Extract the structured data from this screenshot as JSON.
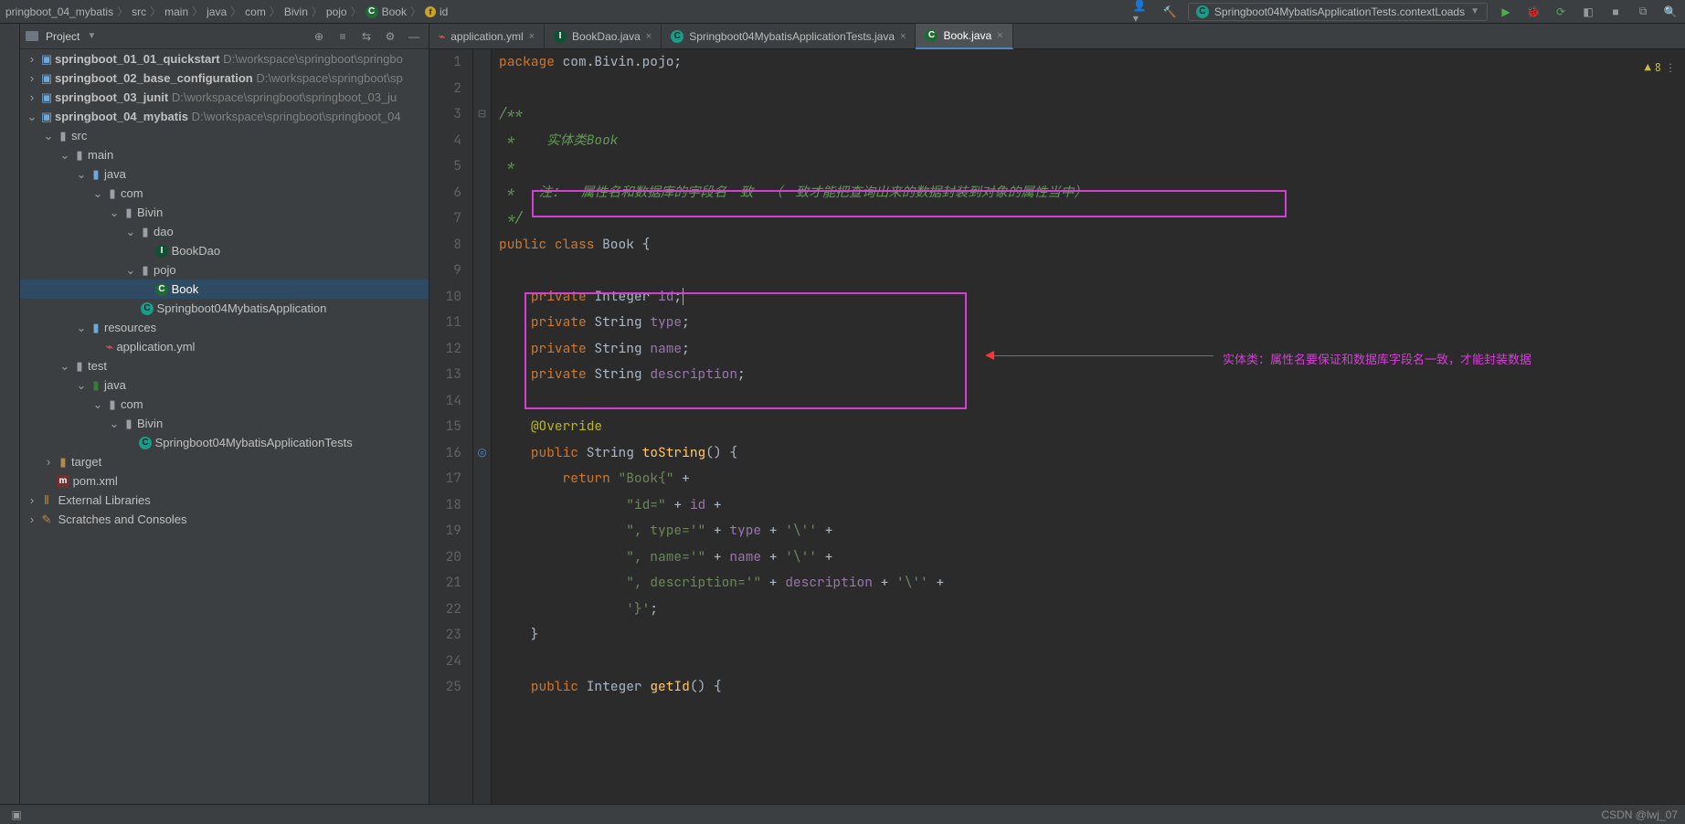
{
  "breadcrumbs": [
    "pringboot_04_mybatis",
    "src",
    "main",
    "java",
    "com",
    "Bivin",
    "pojo",
    "Book",
    "id"
  ],
  "run_config": "Springboot04MybatisApplicationTests.contextLoads",
  "project_panel_title": "Project",
  "tree": {
    "mods": [
      {
        "name": "springboot_01_01_quickstart",
        "path": "D:\\workspace\\springboot\\springbo"
      },
      {
        "name": "springboot_02_base_configuration",
        "path": "D:\\workspace\\springboot\\sp"
      },
      {
        "name": "springboot_03_junit",
        "path": "D:\\workspace\\springboot\\springboot_03_ju"
      },
      {
        "name": "springboot_04_mybatis",
        "path": "D:\\workspace\\springboot\\springboot_04"
      }
    ],
    "src": "src",
    "main": "main",
    "java": "java",
    "com": "com",
    "Bivin": "Bivin",
    "dao": "dao",
    "BookDao": "BookDao",
    "pojo": "pojo",
    "Book": "Book",
    "AppMain": "Springboot04MybatisApplication",
    "resources": "resources",
    "appyml": "application.yml",
    "test": "test",
    "java2": "java",
    "com2": "com",
    "Bivin2": "Bivin",
    "AppTests": "Springboot04MybatisApplicationTests",
    "target": "target",
    "pom": "pom.xml",
    "extlibs": "External Libraries",
    "scratches": "Scratches and Consoles"
  },
  "tabs": [
    {
      "label": "application.yml",
      "kind": "yml"
    },
    {
      "label": "BookDao.java",
      "kind": "iface"
    },
    {
      "label": "Springboot04MybatisApplicationTests.java",
      "kind": "class"
    },
    {
      "label": "Book.java",
      "kind": "class",
      "active": true
    }
  ],
  "code": {
    "l1": "package com.Bivin.pojo;",
    "l2": "",
    "l3": "/**",
    "l4": " *    实体类Book",
    "l5": " *",
    "l6": " *   注：  属性名和数据库的字段名一致  （一致才能把查询出来的数据封装到对象的属性当中）",
    "l7": " */",
    "l8": "public class Book {",
    "l9": "",
    "l10": "    private Integer id;",
    "l11": "    private String type;",
    "l12": "    private String name;",
    "l13": "    private String description;",
    "l14": "",
    "l15": "    @Override",
    "l16": "    public String toString() {",
    "l17": "        return \"Book{\" +",
    "l18": "                \"id=\" + id +",
    "l19": "                \", type='\" + type + '\\'' +",
    "l20": "                \", name='\" + name + '\\'' +",
    "l21": "                \", description='\" + description + '\\'' +",
    "l22": "                '}';",
    "l23": "    }",
    "l24": "",
    "l25": "    public Integer getId() {"
  },
  "annotation_text": "实体类：属性名要保证和数据库字段名一致，才能封装数据",
  "inspections_count": "8",
  "watermark": "CSDN @lwj_07"
}
